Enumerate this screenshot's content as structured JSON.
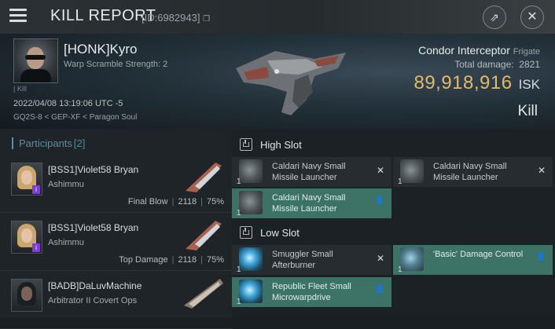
{
  "header": {
    "title": "KILL REPORT",
    "report_id": "[ID:6982943]",
    "share_icon": "share-icon",
    "close_icon": "close-icon"
  },
  "victim": {
    "name": "[HONK]Kyro",
    "warp_scramble": "Warp Scramble Strength: 2",
    "sub_label": "Kill",
    "datetime": "2022/04/08 13:19:06 UTC -5",
    "location": "GQ2S-8 < GEP-XF < Paragon Soul",
    "ship_name": "Condor Interceptor",
    "ship_class": "Frigate",
    "total_damage_label": "Total damage:",
    "total_damage": "2821",
    "isk_value": "89,918,916",
    "isk_unit": "ISK",
    "result": "Kill"
  },
  "participants": {
    "label": "Participants",
    "count": "[2]",
    "rows": [
      {
        "name": "[BSS1]Violet58 Bryan",
        "ship": "Ashimmu",
        "role": "Final Blow",
        "damage": "2118",
        "percent": "75%"
      },
      {
        "name": "[BSS1]Violet58 Bryan",
        "ship": "Ashimmu",
        "role": "Top Damage",
        "damage": "2118",
        "percent": "75%"
      },
      {
        "name": "[BADB]DaLuvMachine",
        "ship": "Arbitrator II Covert Ops",
        "role": "",
        "damage": "",
        "percent": ""
      }
    ]
  },
  "fitting": {
    "high_slot": {
      "label": "High Slot",
      "modules": [
        {
          "qty": "1",
          "name": "Caldari Navy Small Missile Launcher",
          "status": "destroyed"
        },
        {
          "qty": "1",
          "name": "Caldari Navy Small Missile Launcher",
          "status": "destroyed"
        },
        {
          "qty": "1",
          "name": "Caldari Navy Small Missile Launcher",
          "status": "dropped"
        }
      ]
    },
    "low_slot": {
      "label": "Low Slot",
      "modules": [
        {
          "qty": "1",
          "name": "Smuggler Small Afterburner",
          "status": "destroyed"
        },
        {
          "qty": "1",
          "name": "'Basic' Damage Control",
          "status": "dropped"
        },
        {
          "qty": "1",
          "name": "Republic Fleet Small Microwarpdrive",
          "status": "dropped"
        }
      ]
    },
    "destroyed_mark": "✕",
    "dropped_mark": "👤"
  }
}
